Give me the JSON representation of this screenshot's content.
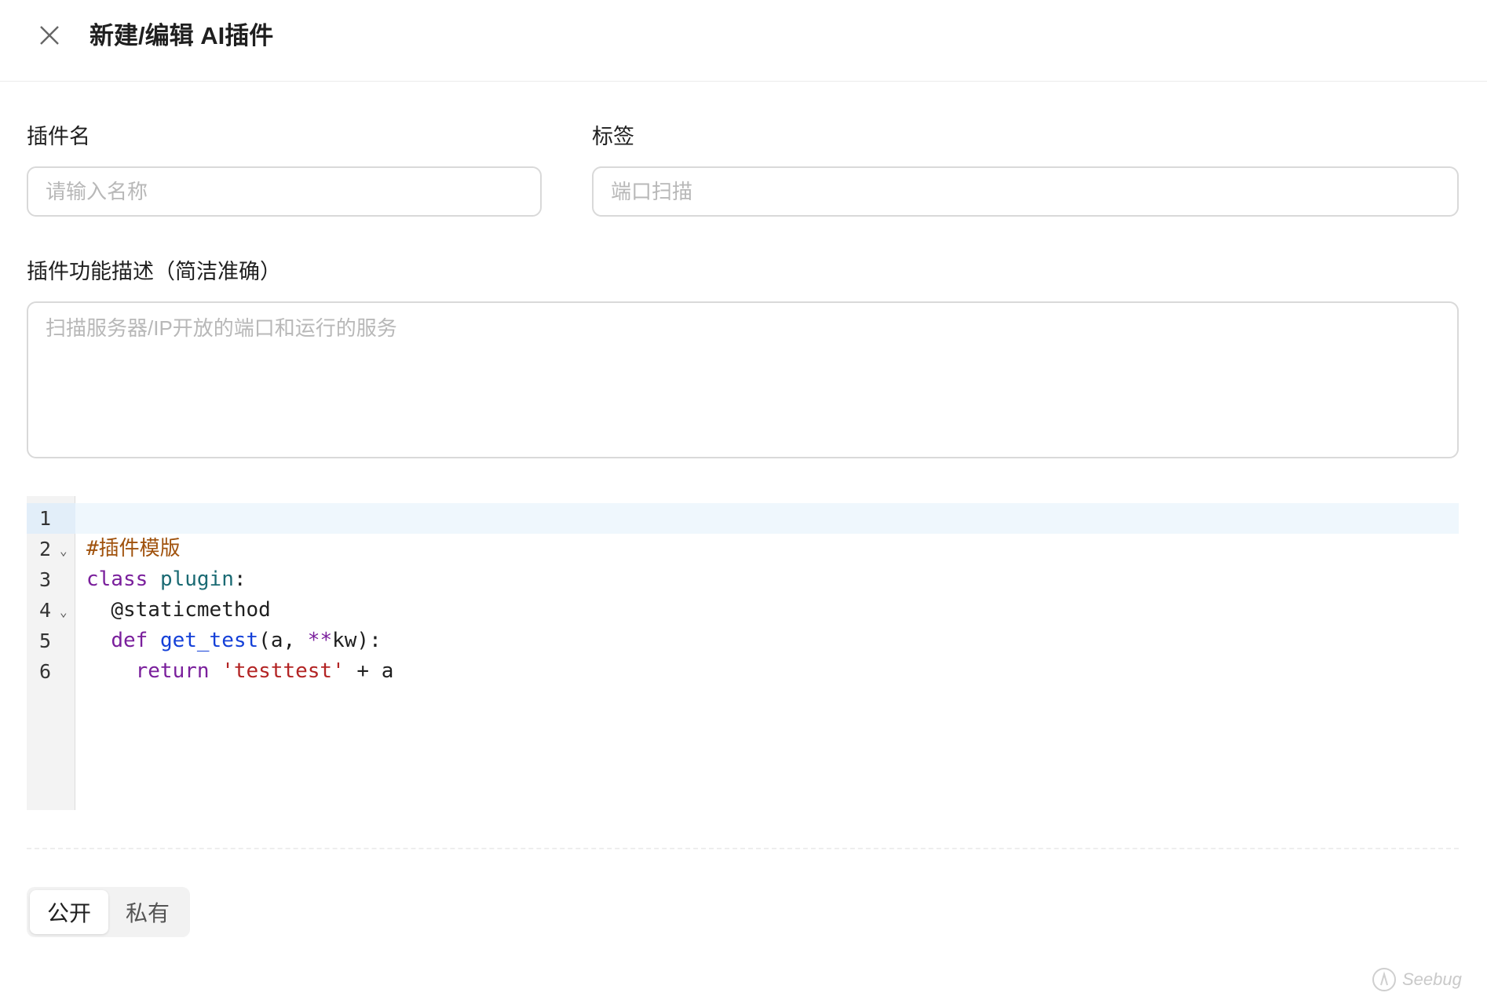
{
  "header": {
    "title": "新建/编辑 AI插件",
    "close_icon": "close-icon"
  },
  "form": {
    "plugin_name": {
      "label": "插件名",
      "placeholder": "请输入名称",
      "value": ""
    },
    "tags": {
      "label": "标签",
      "placeholder": "端口扫描",
      "value": ""
    },
    "description": {
      "label": "插件功能描述（简洁准确）",
      "placeholder": "扫描服务器/IP开放的端口和运行的服务",
      "value": ""
    }
  },
  "editor": {
    "language": "python",
    "active_line": 1,
    "lines": [
      {
        "number": "1",
        "foldable": false,
        "text": "#插件模版"
      },
      {
        "number": "2",
        "foldable": true,
        "text": "class plugin:"
      },
      {
        "number": "3",
        "foldable": false,
        "text": "  @staticmethod"
      },
      {
        "number": "4",
        "foldable": true,
        "text": "  def get_test(a, **kw):"
      },
      {
        "number": "5",
        "foldable": false,
        "text": "    return 'testtest' + a"
      },
      {
        "number": "6",
        "foldable": false,
        "text": ""
      }
    ],
    "tokens": {
      "l1_comment": "#插件模版",
      "l2_kw": "class",
      "l2_cls": "plugin",
      "l2_colon": ":",
      "l3_deco": "@staticmethod",
      "l4_kw": "def",
      "l4_fn": "get_test",
      "l4_args_open": "(a, ",
      "l4_star": "**",
      "l4_args_close": "kw):",
      "l5_kw": "return",
      "l5_str": "'testtest'",
      "l5_rest": " + a"
    }
  },
  "visibility": {
    "options": [
      "公开",
      "私有"
    ],
    "selected": "公开"
  },
  "watermark": {
    "text": "Seebug"
  }
}
